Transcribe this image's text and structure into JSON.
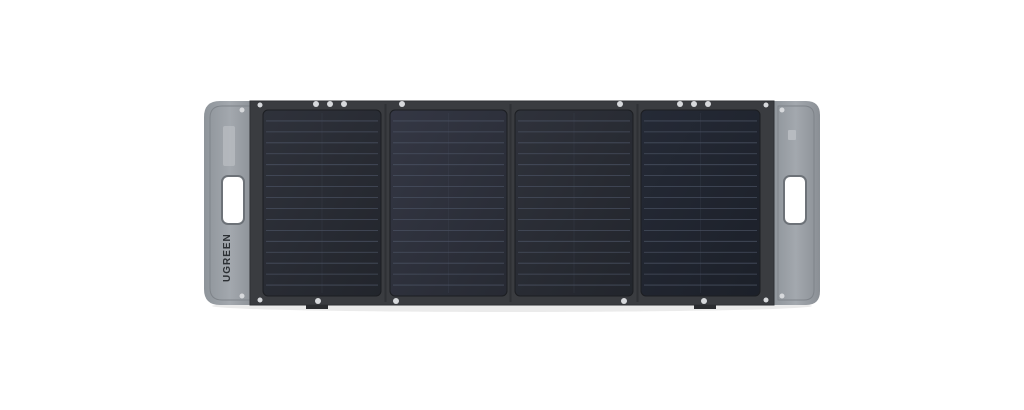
{
  "product": {
    "brand": "UGREEN",
    "panel_count": 4,
    "colors": {
      "background": "#ffffff",
      "fabric": "#3a3c40",
      "end_cap": "#9a9fa5",
      "cell": "#2a2d35",
      "grid_line": "#4d5566",
      "grommet": "#d7d9dc"
    }
  }
}
